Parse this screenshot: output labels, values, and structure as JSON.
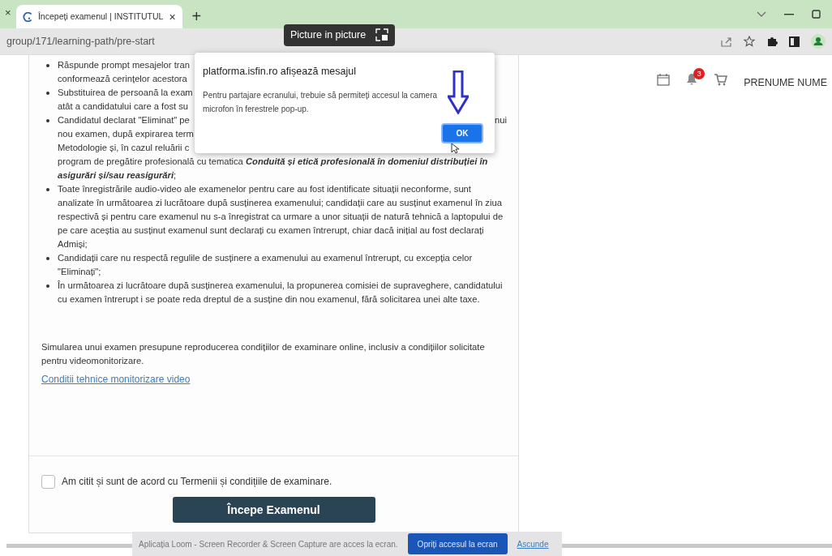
{
  "browser": {
    "prev_tab_close": "×",
    "tabs": [
      {
        "title": "Începeți examenul | INSTITUTUL",
        "close": "×",
        "selected": true
      }
    ],
    "new_tab": "+",
    "address": "group/171/learning-path/pre-start",
    "pip_tooltip": "Picture in picture"
  },
  "header": {
    "notification_count": "3",
    "user_name": "PRENUME NUME"
  },
  "lines": [
    {
      "kind": "bullet",
      "text": "Răspunde prompt mesajelor tran"
    },
    {
      "kind": "cont",
      "text": "conformează cerințelor acestora"
    },
    {
      "kind": "bullet",
      "text": "Substituirea de persoană la exam"
    },
    {
      "kind": "cont",
      "text": "atât a candidatului care a fost su"
    },
    {
      "kind": "bullet",
      "text": "Candidatul declarat \"Eliminat\" pe",
      "trailing": "nui"
    },
    {
      "kind": "cont",
      "text": "nou examen, după expirarea term"
    },
    {
      "kind": "cont",
      "text": "Metodologie și, în cazul reluării c"
    },
    {
      "kind": "cont",
      "text": "program de pregătire profesională cu tematica **Conduită și etică profesională în domeniul distribuției în**"
    },
    {
      "kind": "cont",
      "text": "**asigurări și/sau reasigurări**;"
    }
  ],
  "bullets": [
    "Toate înregistrările audio-video ale examenelor pentru care au fost identificate situații neconforme, sunt analizate în următoarea zi lucrătoare după susținerea examenului; candidații care au susținut examenul în ziua respectivă și pentru care examenul nu s-a înregistrat ca urmare a unor situații de natură tehnică a laptopului de pe care aceștia au susținut examenul sunt declarați cu examen întrerupt, chiar dacă inițial au fost declarați Admiși;",
    "Candidații care nu respectă regulile de susținere a examenului au examenul întrerupt, cu excepția celor \"Eliminați\";",
    "În următoarea zi lucrătoare după susținerea examenului, la propunerea comisiei de supraveghere, candidatului cu examen întrerupt i se poate reda dreptul de a susține din nou examenul, fără solicitarea unei alte taxe."
  ],
  "simulation_text": "Simularea unui examen presupune reproducerea condițiilor de examinare online, inclusiv a condițiilor solicitate pentru videomonitorizare.",
  "link": "Conditii tehnice monitorizare video",
  "agreement": {
    "label": "Am citit și sunt de acord cu Termenii și condițiile de examinare.",
    "checked": false
  },
  "start_button": "Începe Examenul",
  "dialog": {
    "title": "platforma.isfin.ro afișează mesajul",
    "message_lines": [
      "Pentru partajare ecranului, trebuie să permiteți accesul la camera",
      "microfon în ferestrele pop-up."
    ],
    "ok": "OK"
  },
  "share_bar": {
    "message": "Aplicația Loom - Screen Recorder & Screen Capture are acces la ecran.",
    "stop": "Opriți accesul la ecran",
    "hide": "Ascunde"
  }
}
